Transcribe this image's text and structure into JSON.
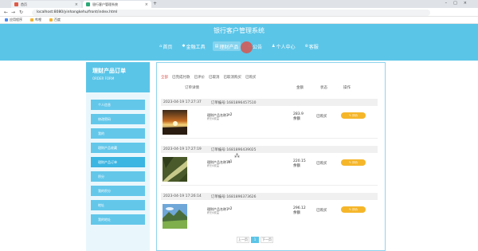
{
  "browser": {
    "tabs": [
      {
        "title": "首页",
        "favicon_color": "#e05a47"
      },
      {
        "title": "银行客户管理系统",
        "favicon_color": "#2aa876"
      }
    ],
    "url": "localhost:8080/yinhangkehu/front/index.html",
    "bookmarks": [
      "应用程序",
      "哔哩",
      "百度"
    ]
  },
  "site": {
    "title": "银行客户管理系统",
    "nav": [
      {
        "icon": "home-icon",
        "label": "首页"
      },
      {
        "icon": "finance-tool-icon",
        "label": "金融工具"
      },
      {
        "icon": "product-icon",
        "label": "理财产品"
      },
      {
        "icon": "bulletin-icon",
        "label": "公告"
      },
      {
        "icon": "person-icon",
        "label": "个人中心"
      },
      {
        "icon": "cart-icon",
        "label": "客服"
      }
    ],
    "active_nav": 2
  },
  "sidebar": {
    "title": "理财产品订单",
    "subtitle": "ORDER FORM",
    "items": [
      "个人信息",
      "修改密码",
      "我的",
      "理财产品收藏",
      "理财产品订单",
      "积分",
      "我的积分",
      "地址",
      "我的地址"
    ],
    "active_index": 4
  },
  "main": {
    "filter_tabs": [
      "全部",
      "已完成付款",
      "已评价",
      "已取消",
      "已取消购买",
      "已购买"
    ],
    "active_filter": 0,
    "columns": {
      "detail": "订单详情",
      "amount": "金额",
      "status": "状态",
      "action": "操作"
    },
    "orders": [
      {
        "date": "2023-04-19 17:27:37",
        "order_no": "订单编号:1681896457510",
        "product": "理财产品名称3",
        "desc": "积分/收益",
        "qty": "x2",
        "price": "283.9",
        "unit": "余额",
        "status": "已购买",
        "action": "评价"
      },
      {
        "date": "2023-04-19 17:27:19",
        "order_no": "订单编号:1681896439025",
        "product": "理财产品名称10",
        "desc": "积分/收益",
        "qty": "x1",
        "price": "220.15",
        "unit": "余额",
        "status": "已购买",
        "action": "评价"
      },
      {
        "date": "2023-04-19 17:26:14",
        "order_no": "订单编号:1681896373626",
        "product": "理财产品名称1",
        "desc": "积分/收益",
        "qty": "x2",
        "price": "296.12",
        "unit": "余额",
        "status": "已购买",
        "action": "评价"
      }
    ],
    "pagination": {
      "prev": "上一页",
      "current": "1",
      "next": "下一页"
    }
  },
  "colors": {
    "primary": "#5bc5e8",
    "button": "#f5b62a",
    "active_filter": "#d9534f"
  }
}
